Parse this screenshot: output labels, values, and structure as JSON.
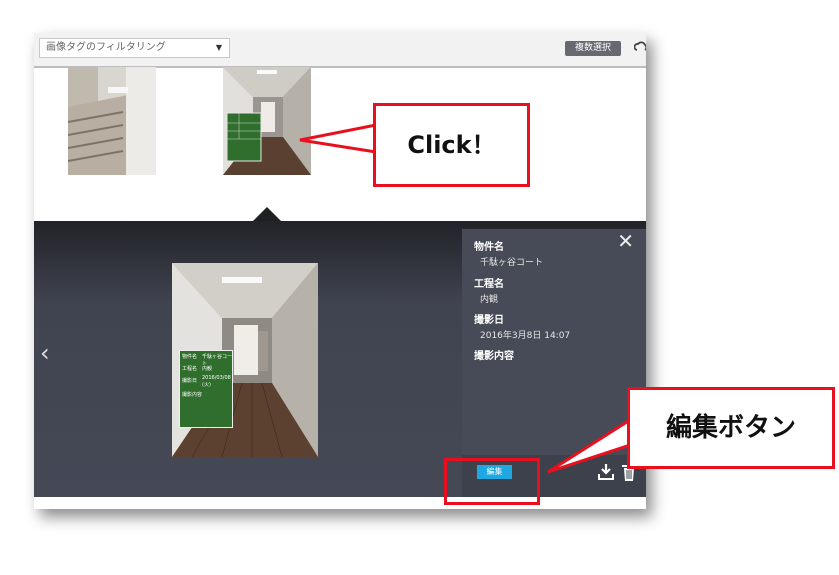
{
  "toolbar": {
    "filter_placeholder": "画像タグのフィルタリング",
    "multi_select_label": "複数選択"
  },
  "photo_board": {
    "fields": [
      {
        "label": "物件名",
        "value": "千駄ヶ谷コート"
      },
      {
        "label": "工程名",
        "value": "内観"
      },
      {
        "label": "撮影日",
        "value": "2016/03/08 (火)"
      },
      {
        "label": "撮影内容",
        "value": ""
      }
    ]
  },
  "info": {
    "property_label": "物件名",
    "property_value": "千駄ヶ谷コート",
    "process_label": "工程名",
    "process_value": "内観",
    "date_label": "撮影日",
    "date_value": "2016年3月8日 14:07",
    "content_label": "撮影内容"
  },
  "actions": {
    "edit_label": "編集"
  },
  "annotations": {
    "click_note": "Click！",
    "edit_note": "編集ボタン",
    "accent_red": "#e8101e"
  }
}
